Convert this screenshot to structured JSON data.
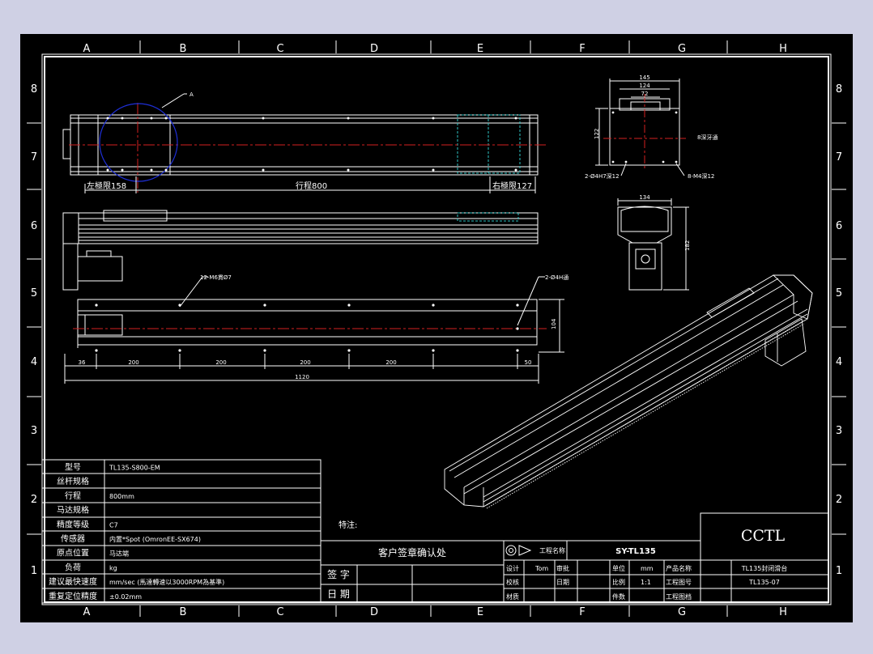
{
  "zones": {
    "columns": [
      "A",
      "B",
      "C",
      "D",
      "E",
      "F",
      "G",
      "H"
    ],
    "rows": [
      "8",
      "7",
      "6",
      "5",
      "4",
      "3",
      "2",
      "1"
    ]
  },
  "top_view": {
    "callout": "A",
    "left_limit": "左極限158",
    "stroke": "行程800",
    "right_limit": "右極限127"
  },
  "end_view": {
    "dims": [
      "145",
      "124",
      "72"
    ],
    "height": "122",
    "note_right": "8深牙通",
    "note_bl": "2-Ø4H7深12",
    "note_br": "8-M4深12"
  },
  "section_view": {
    "width": "134",
    "height": "182"
  },
  "bottom_view": {
    "note_left": "12-M6貫Ø7",
    "note_right": "2-Ø4H通",
    "height": "104",
    "segments": [
      "36",
      "200",
      "200",
      "200",
      "200",
      "50"
    ],
    "total": "1120"
  },
  "spec_table": [
    {
      "label": "型号",
      "value": "TL135-S800-EM"
    },
    {
      "label": "丝杆规格",
      "value": ""
    },
    {
      "label": "行程",
      "value": "800mm"
    },
    {
      "label": "马达规格",
      "value": ""
    },
    {
      "label": "精度等级",
      "value": "C7"
    },
    {
      "label": "传感器",
      "value": "内置*Spot (OmronEE-SX674)"
    },
    {
      "label": "原点位置",
      "value": "马达端"
    },
    {
      "label": "负荷",
      "value": "kg"
    },
    {
      "label": "建议最快速度",
      "value": "mm/sec (馬達轉速以3000RPM為基準)"
    },
    {
      "label": "重复定位精度",
      "value": "±0.02mm"
    }
  ],
  "notes_label": "特注:",
  "customer": {
    "title": "客户签章确认处",
    "sign": "签 字",
    "date": "日 期"
  },
  "title_block": {
    "project_label": "工程名称",
    "project_value": "SY-TL135",
    "design": "设计",
    "design_value": "Tom",
    "approve": "审批",
    "check": "校核",
    "date": "日期",
    "material": "材质",
    "unit": "单位",
    "unit_value": "mm",
    "scale": "比例",
    "scale_value": "1:1",
    "qty": "件数",
    "product_name_label": "产品名称",
    "product_name_value": "TL135封闭滑台",
    "drawing_no_label": "工程图号",
    "drawing_no_value": "TL135-07",
    "drawing_file_label": "工程图档",
    "company": "CCTL"
  },
  "colors": {
    "line": "#ffffff",
    "center": "#d42020",
    "hidden": "#2ec4c4",
    "circle": "#1e2fd8",
    "sheet": "#000000",
    "page": "#cfd0e4"
  }
}
